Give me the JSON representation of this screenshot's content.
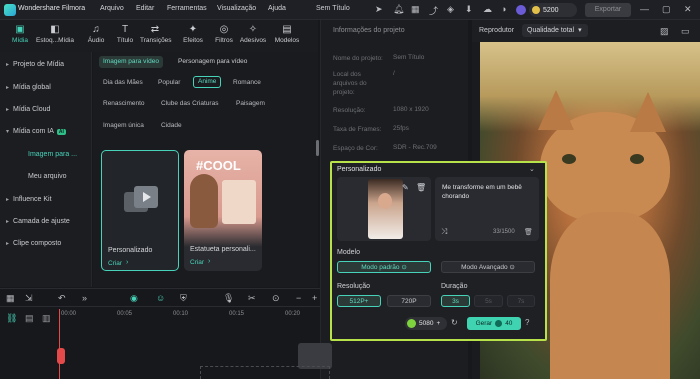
{
  "titlebar": {
    "app": "Wondershare Filmora",
    "menu": [
      "Arquivo",
      "Editar",
      "Ferramentas",
      "Visualização",
      "Ajuda"
    ],
    "project": "Sem Título",
    "credits": "5200",
    "export": "Exportar"
  },
  "toolbar": [
    {
      "label": "Mídia",
      "icon": "media-icon",
      "glyph": "▣"
    },
    {
      "label": "Estoq...Mídia",
      "icon": "stock-media-icon",
      "glyph": "◧"
    },
    {
      "label": "Áudio",
      "icon": "music-icon",
      "glyph": "♫"
    },
    {
      "label": "Título",
      "icon": "title-icon",
      "glyph": "T"
    },
    {
      "label": "Transições",
      "icon": "transition-icon",
      "glyph": "⇄"
    },
    {
      "label": "Efeitos",
      "icon": "effects-icon",
      "glyph": "✦"
    },
    {
      "label": "Filtros",
      "icon": "filter-icon",
      "glyph": "◎"
    },
    {
      "label": "Adesivos",
      "icon": "sticker-icon",
      "glyph": "✧"
    },
    {
      "label": "Modelos",
      "icon": "template-icon",
      "glyph": "▤"
    }
  ],
  "sidebar": {
    "items": [
      "Projeto de Mídia",
      "Mídia global",
      "Mídia Cloud",
      "Mídia com IA",
      "Influence Kit",
      "Camada de ajuste",
      "Clipe composto"
    ],
    "ai_badge": "AI",
    "sub": [
      "Imagem para ...",
      "Meu arquivo"
    ]
  },
  "content": {
    "tabs": [
      "Imagem para vídeo",
      "Personagem para vídeo"
    ],
    "categories": [
      "Dia das Mães",
      "Popular",
      "Anime",
      "Romance",
      "Renascimento",
      "Clube das Criaturas",
      "Paisagem",
      "Imagem única",
      "Cidade"
    ],
    "cards": [
      {
        "title": "Personalizado",
        "action": "Criar"
      },
      {
        "title": "Estatueta personali...",
        "action": "Criar",
        "overlay": "#COOL"
      }
    ]
  },
  "properties": {
    "title": "Informações do projeto",
    "rows": [
      {
        "label": "Nome do projeto:",
        "value": "Sem Título"
      },
      {
        "label": "Local dos arquivos do projeto:",
        "value": "/"
      },
      {
        "label": "Resolução:",
        "value": "1080 x 1920"
      },
      {
        "label": "Taxa de Frames:",
        "value": "25fps"
      },
      {
        "label": "Espaço de Cor:",
        "value": "SDR - Rec.709"
      }
    ]
  },
  "player": {
    "label": "Reprodutor",
    "quality": "Qualidade total"
  },
  "timeline": {
    "ticks": [
      "00:00",
      "00:05",
      "00:10",
      "00:15",
      "00:20"
    ]
  },
  "modal": {
    "title": "Personalizado",
    "prompt": "Me transforme em um bebê chorando",
    "counter": "33/1500",
    "model_label": "Modelo",
    "models": [
      "Modo padrão",
      "Modo Avançado"
    ],
    "res_label": "Resolução",
    "resolutions": [
      "512P+",
      "720P"
    ],
    "dur_label": "Duração",
    "durations": [
      "3s",
      "5s",
      "7s"
    ],
    "credits": "5080",
    "generate": "Gerar",
    "generate_cost": "40"
  }
}
